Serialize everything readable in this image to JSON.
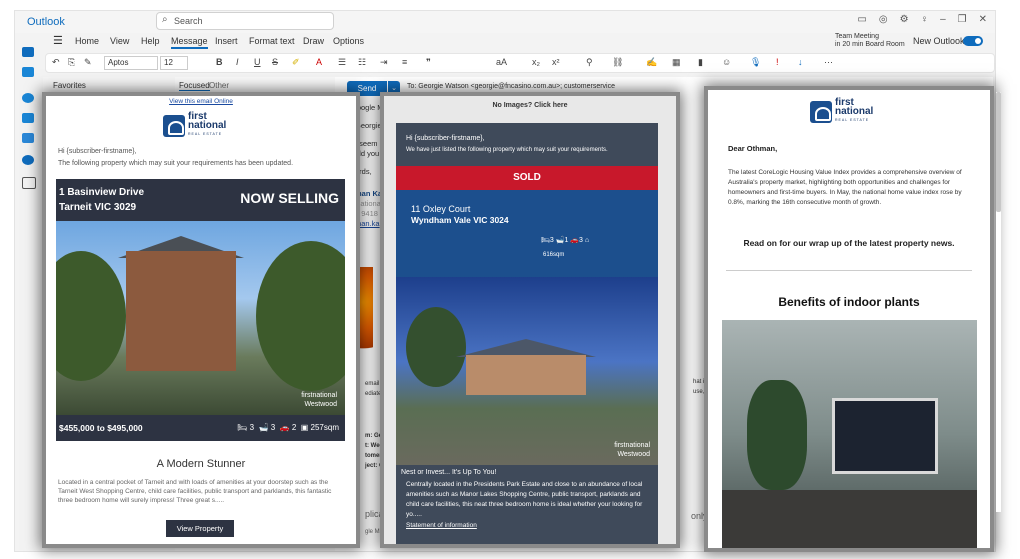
{
  "app": {
    "name": "Outlook",
    "search_placeholder": "Search"
  },
  "ribbon": {
    "tabs": [
      "Home",
      "View",
      "Help",
      "Message",
      "Insert",
      "Format text",
      "Draw",
      "Options"
    ],
    "active_tab": "Message",
    "font_name": "Aptos",
    "font_size": "12",
    "meeting_title": "Team Meeting",
    "meeting_sub": "in 20 min Board Room",
    "new_outlook_label": "New Outlook"
  },
  "folders": {
    "favorites": "Favorites",
    "focused": "Focused",
    "other": "Other"
  },
  "compose": {
    "send_label": "Send",
    "to_line": "To:  Georgie Watson <georgie@fncasino.com.au>;  customerservice",
    "bg_lines": [
      "Google M",
      "Georgie,",
      "t seem",
      "uld you n",
      "ards,",
      "man Ka",
      "Nationa",
      "3 9418 9",
      "man.ka",
      "email an",
      "ediately",
      "m: Georgi",
      "t: Wedne",
      "tomers",
      "ject: Goo",
      "plicate",
      "gle Map",
      "hat is con",
      "use, copy,",
      "only."
    ]
  },
  "email1": {
    "view_online": "View this email Online",
    "logo_line1": "first",
    "logo_line2": "national",
    "logo_sub": "REAL ESTATE",
    "greeting": "Hi {subscriber-firstname},",
    "intro": "The following property which may suit your requirements has been updated.",
    "address1": "1 Basinview Drive",
    "address2": "Tarneit VIC 3029",
    "status": "NOW SELLING",
    "watermark1": "firstnational",
    "watermark2": "Westwood",
    "price": "$455,000 to $495,000",
    "beds": "3",
    "baths": "3",
    "cars": "2",
    "area": "257sqm",
    "title": "A Modern Stunner",
    "description": "Located in a central pocket of Tarneit and with loads of amenities at your doorstep such as the Tarneit West Shopping Centre, child care facilities, public transport and parklands, this fantastic three bedroom home will surely impress! Three great s.....",
    "button": "View Property"
  },
  "email2": {
    "no_images": "No Images? Click here",
    "greeting": "Hi {subscriber-firstname},",
    "intro": "We have just listed the following property which may suit your requirements.",
    "status": "SOLD",
    "address1": "11 Oxley Court",
    "address2": "Wyndham Vale VIC 3024",
    "beds": "3",
    "baths": "1",
    "cars": "3",
    "size": "616sqm",
    "watermark1": "firstnational",
    "watermark2": "Westwood",
    "headline": "Nest or Invest... It's Up To You!",
    "description": "Centrally located in the Presidents Park Estate and close to an abundance of local amenities such as Manor Lakes Shopping Centre, public transport, parklands and child care facilities, this neat three bedroom home is ideal whether your looking for yo.....",
    "link": "Statement of information"
  },
  "email3": {
    "logo_line1": "first",
    "logo_line2": "national",
    "logo_sub": "REAL ESTATE",
    "salutation": "Dear Othman,",
    "body": "The latest CoreLogic Housing Value Index provides a comprehensive overview of Australia's property market, highlighting both opportunities and challenges for homeowners and first-time buyers. In May, the national home value index rose by 0.8%, marking the 16th consecutive month of growth.",
    "read_on": "Read on for our wrap up of the latest property news.",
    "article_title": "Benefits of indoor plants"
  }
}
